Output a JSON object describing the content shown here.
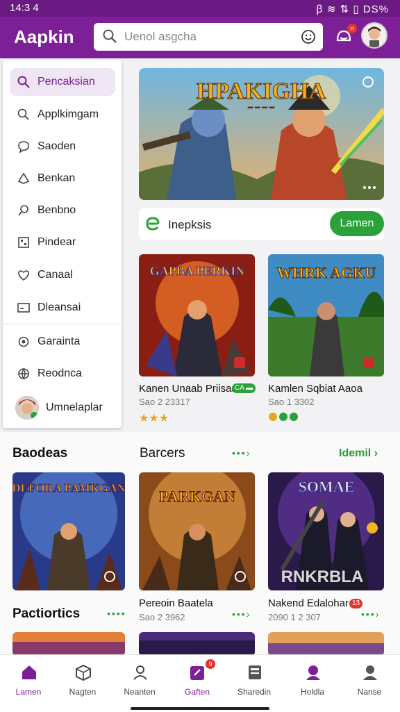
{
  "status": {
    "time": "14:3 4",
    "right": "ꞵ ≋ ⇅ ▯ DS%"
  },
  "app": {
    "title": "Aapkin",
    "accent": "#7d1f97",
    "green": "#2aa13a"
  },
  "search": {
    "placeholder": "Uenol asgcha",
    "icon": "search-icon"
  },
  "header": {
    "notification_count": "n"
  },
  "drawer": {
    "items": [
      {
        "label": "Pencaksian",
        "icon": "search-icon",
        "active": true
      },
      {
        "label": "Applkimgam",
        "icon": "apps-icon"
      },
      {
        "label": "Saoden",
        "icon": "chat-icon"
      },
      {
        "label": "Benkan",
        "icon": "tag-icon"
      },
      {
        "label": "Benbno",
        "icon": "person-search-icon"
      },
      {
        "label": "Pindear",
        "icon": "grid-icon"
      },
      {
        "label": "Canaal",
        "icon": "heart-icon"
      },
      {
        "label": "Dleansai",
        "icon": "card-icon"
      },
      {
        "label": "Garainta",
        "icon": "target-icon"
      },
      {
        "label": "Reodnca",
        "icon": "globe-icon"
      }
    ],
    "user": {
      "name": "Umnelaplar"
    }
  },
  "hero": {
    "title": "HPAKIGHA",
    "subtitle": "▬ ▬ ▬ ▬"
  },
  "promo": {
    "label": "Inepksis",
    "button": "Lamen"
  },
  "featured": [
    {
      "art": "GAPBA PERKIN",
      "title": "Kanen Unaab Priisaa",
      "tag": "CA ▬",
      "sub": "Sao 2 23317",
      "rating": "★★★"
    },
    {
      "art": "WHRK AGKU",
      "title": "Kamlen Sqbiat Aaoa",
      "tag": "",
      "sub": "Sao 1 3302",
      "rating": ""
    }
  ],
  "sections": {
    "s1": "Baodeas",
    "s2": "Barcers",
    "s2_more": "Idemil",
    "s3": "Pactiortics"
  },
  "grid": [
    {
      "art": "DEFORA PAMKGAN",
      "title": "",
      "sub": ""
    },
    {
      "art": "PARKGAN",
      "title": "Pereoin Baatela",
      "sub": "Sao 2 3962"
    },
    {
      "art": "SOMAE",
      "art2": "RNKRBLA",
      "title": "Nakend Edalohar",
      "tag": "13",
      "sub": "2090 1 2 307"
    }
  ],
  "nav": [
    {
      "label": "Lamen",
      "icon": "home-icon",
      "active": true
    },
    {
      "label": "Nagten",
      "icon": "cube-icon"
    },
    {
      "label": "Neanten",
      "icon": "person-icon"
    },
    {
      "label": "Gaften",
      "icon": "edit-icon",
      "badge": "9"
    },
    {
      "label": "Sharedin",
      "icon": "storage-icon"
    },
    {
      "label": "Holdla",
      "icon": "profile-icon"
    },
    {
      "label": "Nanse",
      "icon": "user-icon"
    }
  ]
}
